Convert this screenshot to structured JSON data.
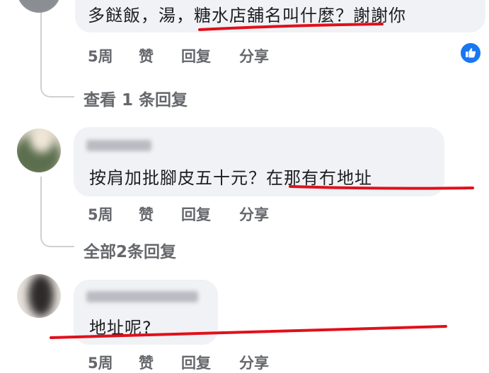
{
  "comments": [
    {
      "text": "多餸飯，湯，糖水店舖名叫什麼？謝謝你",
      "actions": {
        "time": "5周",
        "like": "赞",
        "reply": "回复",
        "share": "分享"
      },
      "view_replies": "查看 1 条回复"
    },
    {
      "text": "按肩加批腳皮五十元？在那有冇地址",
      "actions": {
        "time": "5周",
        "like": "赞",
        "reply": "回复",
        "share": "分享"
      },
      "view_replies": "全部2条回复"
    },
    {
      "text": "地址呢?",
      "actions": {
        "time": "5周",
        "like": "赞",
        "reply": "回复",
        "share": "分享"
      }
    }
  ],
  "colors": {
    "bubble": "#f0f2f5",
    "meta_text": "#65676b",
    "annotation_red": "#e0101a",
    "like_blue": "#1877f2"
  },
  "icons": [
    "like-thumb-icon"
  ]
}
